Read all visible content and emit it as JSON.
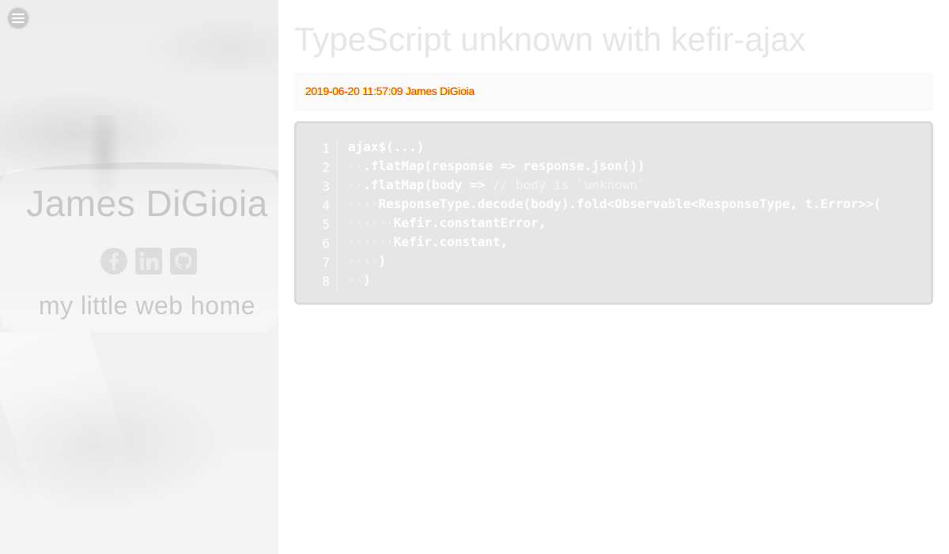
{
  "sidebar": {
    "menu_icon": "hamburger-menu-icon",
    "name": "James DiGioia",
    "tagline": "my little web home",
    "social": [
      {
        "icon": "facebook-icon",
        "label": "Facebook"
      },
      {
        "icon": "linkedin-icon",
        "label": "LinkedIn"
      },
      {
        "icon": "github-icon",
        "label": "GitHub"
      }
    ]
  },
  "post": {
    "title": "TypeScript unknown with kefir-ajax",
    "meta_text_a": "2019-06-20 11:57:09 James DiGioia",
    "meta_text_b": "2019-06-20 11:57:09 James DiGioia",
    "code": {
      "line_numbers": [
        "1",
        "2",
        "3",
        "4",
        "5",
        "6",
        "7",
        "8"
      ],
      "lines": [
        {
          "indent": "",
          "code": "ajax$(...)",
          "comment": ""
        },
        {
          "indent": "··",
          "code": ".flatMap(response => response.json())",
          "comment": ""
        },
        {
          "indent": "··",
          "code": ".flatMap(body =>",
          "comment": " // body is `unknown`"
        },
        {
          "indent": "····",
          "code": "ResponseType.decode(body).fold<Observable<ResponseType, t.Error>>(",
          "comment": ""
        },
        {
          "indent": "······",
          "code": "Kefir.constantError,",
          "comment": ""
        },
        {
          "indent": "······",
          "code": "Kefir.constant,",
          "comment": ""
        },
        {
          "indent": "····",
          "code": ")",
          "comment": ""
        },
        {
          "indent": "··",
          "code": ")",
          "comment": ""
        }
      ]
    }
  },
  "colors": {
    "meta_yellow": "#ffff00",
    "meta_red": "#ff0000",
    "code_bg": "#e6e6e6",
    "title": "#e6e6e6"
  }
}
